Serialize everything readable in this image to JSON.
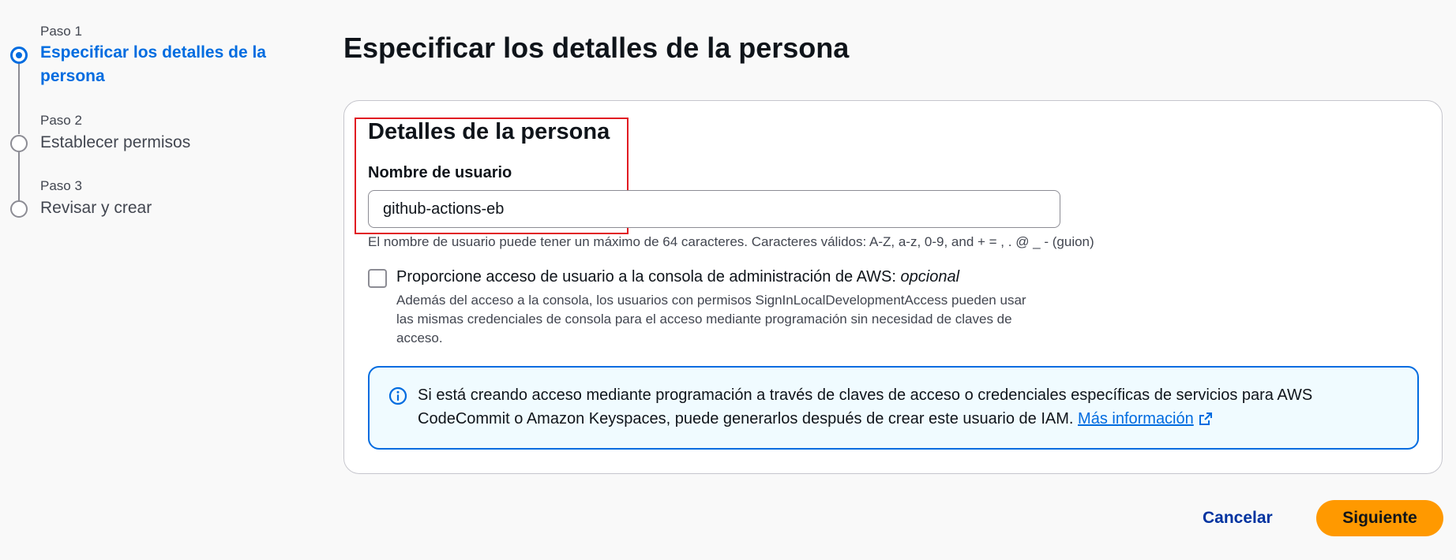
{
  "stepper": {
    "steps": [
      {
        "number": "Paso 1",
        "label": "Especificar los detalles de la persona",
        "state": "active"
      },
      {
        "number": "Paso 2",
        "label": "Establecer permisos",
        "state": "inactive"
      },
      {
        "number": "Paso 3",
        "label": "Revisar y crear",
        "state": "inactive"
      }
    ]
  },
  "main": {
    "page_title": "Especificar los detalles de la persona",
    "section_title": "Detalles de la persona",
    "username": {
      "label": "Nombre de usuario",
      "value": "github-actions-eb",
      "constraint": "El nombre de usuario puede tener un máximo de 64 caracteres. Caracteres válidos: A-Z, a-z, 0-9, and + = , . @ _ - (guion)"
    },
    "console_access": {
      "label": "Proporcione acceso de usuario a la consola de administración de AWS:",
      "optional": "opcional",
      "checked": false,
      "description": "Además del acceso a la consola, los usuarios con permisos SignInLocalDevelopmentAccess pueden usar las mismas credenciales de consola para el acceso mediante programación sin necesidad de claves de acceso."
    },
    "info": {
      "text": "Si está creando acceso mediante programación a través de claves de acceso o credenciales específicas de servicios para AWS CodeCommit o Amazon Keyspaces, puede generarlos después de crear este usuario de IAM.",
      "link": "Más información"
    }
  },
  "footer": {
    "cancel": "Cancelar",
    "next": "Siguiente"
  },
  "colors": {
    "accent": "#006ce0",
    "primary_button": "#ff9900",
    "highlight": "#e11b22",
    "info_bg": "#f0fbff"
  }
}
